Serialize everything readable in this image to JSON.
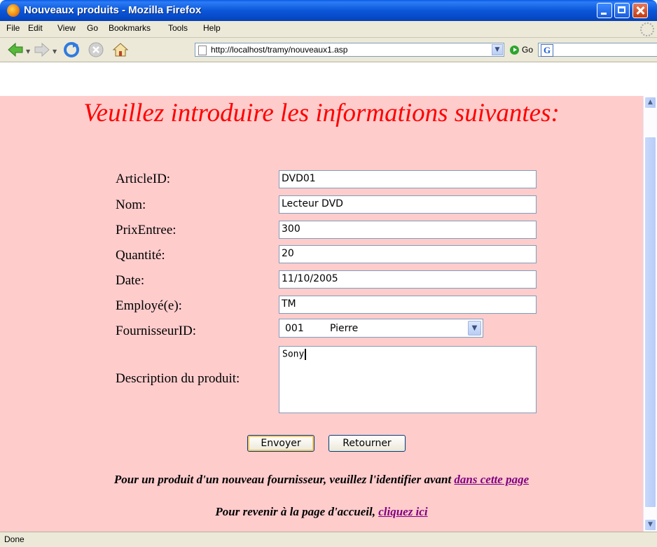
{
  "window": {
    "title": "Nouveaux produits - Mozilla Firefox"
  },
  "menu": {
    "items": [
      "File",
      "Edit",
      "View",
      "Go",
      "Bookmarks",
      "Tools",
      "Help"
    ]
  },
  "nav": {
    "url": "http://localhost/tramy/nouveaux1.asp",
    "go_label": "Go",
    "search_value": ""
  },
  "page": {
    "heading": "Veuillez introduire les informations suivantes:",
    "fields": [
      {
        "label": "ArticleID:",
        "value": "DVD01"
      },
      {
        "label": "Nom:",
        "value": "Lecteur DVD"
      },
      {
        "label": "PrixEntree:",
        "value": "300"
      },
      {
        "label": "Quantité:",
        "value": "20"
      },
      {
        "label": "Date:",
        "value": "11/10/2005"
      },
      {
        "label": "Employé(e):",
        "value": "TM"
      }
    ],
    "supplier": {
      "label": "FournisseurID:",
      "code": "001",
      "name": "Pierre"
    },
    "description": {
      "label": "Description du produit:",
      "value": "Sony"
    },
    "buttons": {
      "submit": "Envoyer",
      "back": "Retourner"
    },
    "note1": {
      "text": "Pour un produit d'un nouveau fournisseur, veuillez l'identifier avant ",
      "link": "dans cette page"
    },
    "note2": {
      "text": "Pour revenir à la page d'accueil, ",
      "link": "cliquez ici"
    }
  },
  "status": {
    "text": "Done"
  },
  "colors": {
    "page_bg": "#ffcccc",
    "heading": "#ff0000",
    "link": "#800080"
  }
}
